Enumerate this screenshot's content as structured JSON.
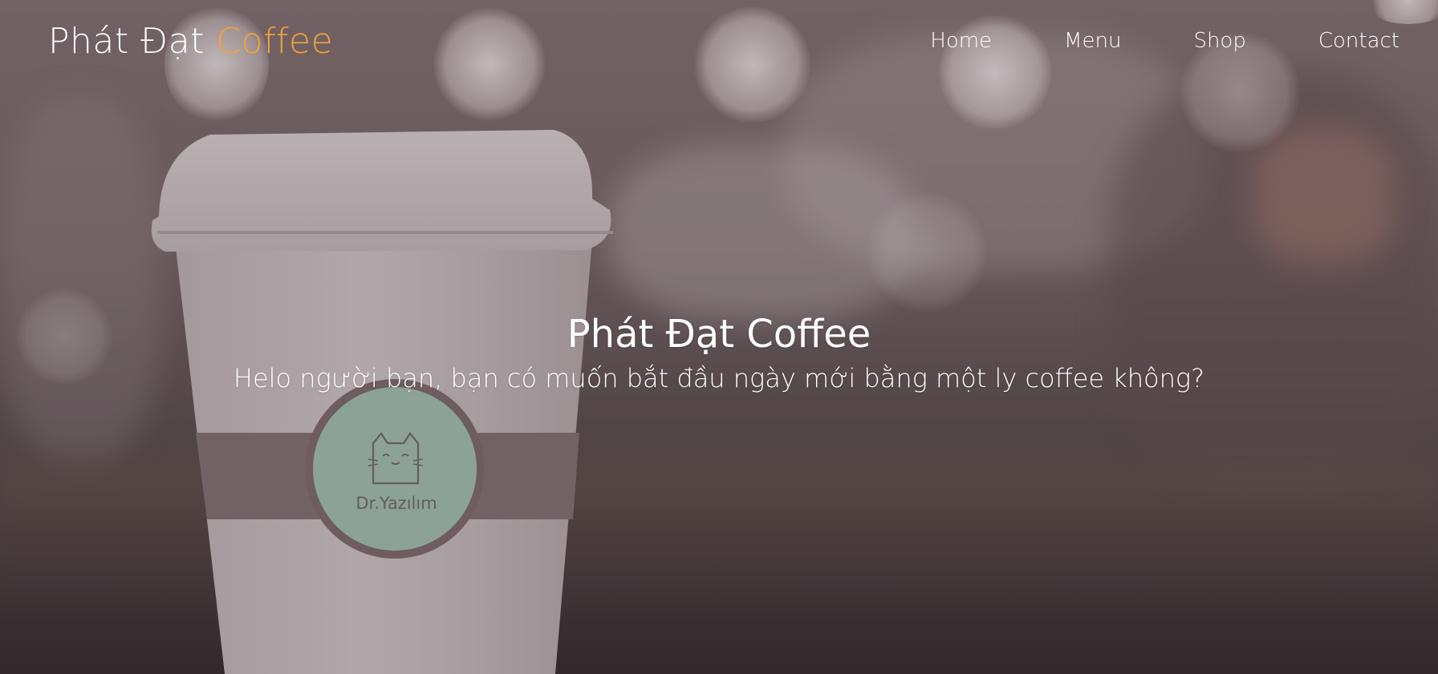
{
  "brand": {
    "name_part1": "Phát Đạt ",
    "name_part2": "Coffee"
  },
  "nav": {
    "links": [
      {
        "label": "Home"
      },
      {
        "label": "Menu"
      },
      {
        "label": "Shop"
      },
      {
        "label": "Contact"
      }
    ]
  },
  "hero": {
    "title": "Phát Đạt Coffee",
    "subtitle": "Helo người bạn, bạn có muốn bắt đầu ngày mới bằng một ly coffee không?",
    "cup_logo_text": "Dr.Yazılım",
    "cup_logo_icon": "cat-face-icon"
  },
  "colors": {
    "accent": "#f2a33a",
    "text": "#ffffff",
    "cup_badge": "#9fc3b6"
  }
}
